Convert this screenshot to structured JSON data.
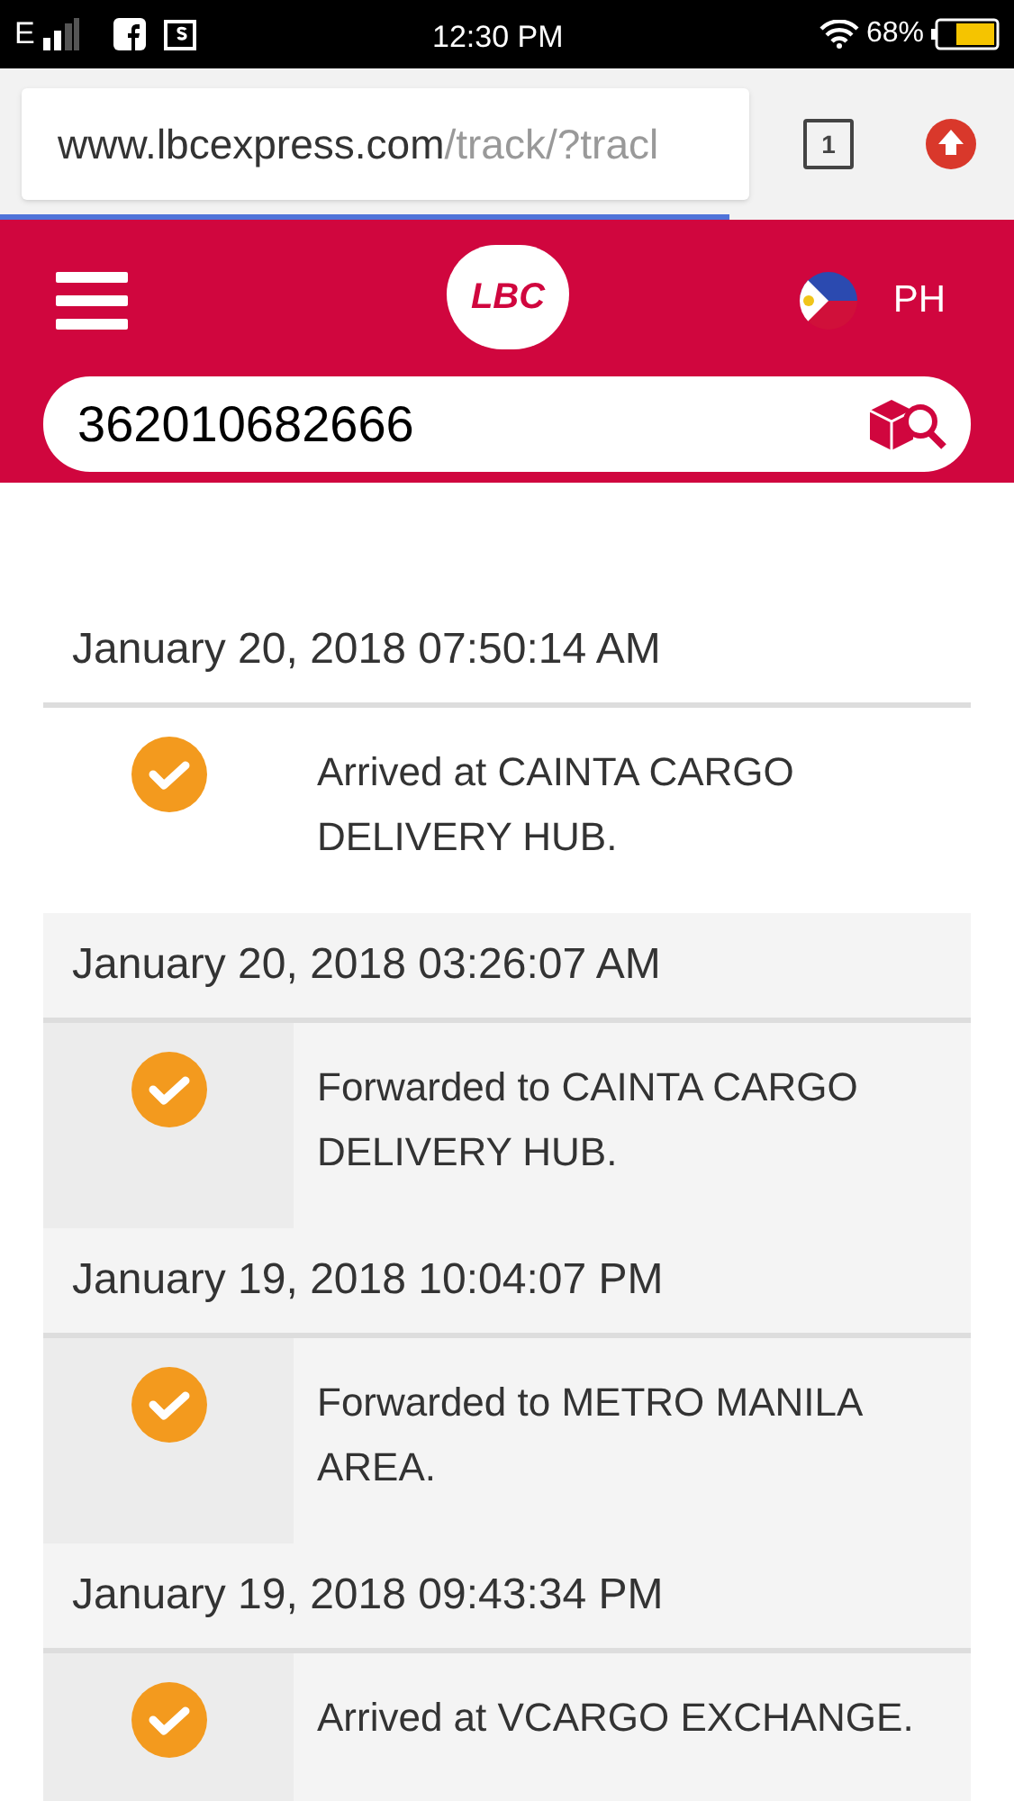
{
  "status_bar": {
    "network": "E",
    "time": "12:30 PM",
    "battery": "68%"
  },
  "browser": {
    "url_domain": "www.lbcexpress.com",
    "url_path": "/track/?tracl",
    "tab_count": "1"
  },
  "header": {
    "logo": "LBC",
    "country": "PH"
  },
  "search": {
    "value": "362010682666"
  },
  "events": [
    {
      "date": "January 20, 2018 07:50:14 AM",
      "status": "Arrived at CAINTA CARGO DELIVERY HUB.",
      "latest": true
    },
    {
      "date": "January 20, 2018 03:26:07 AM",
      "status": "Forwarded to CAINTA CARGO DELIVERY HUB.",
      "latest": false
    },
    {
      "date": "January 19, 2018 10:04:07 PM",
      "status": "Forwarded to METRO MANILA AREA.",
      "latest": false
    },
    {
      "date": "January 19, 2018 09:43:34 PM",
      "status": "Arrived at VCARGO EXCHANGE.",
      "latest": false
    }
  ]
}
